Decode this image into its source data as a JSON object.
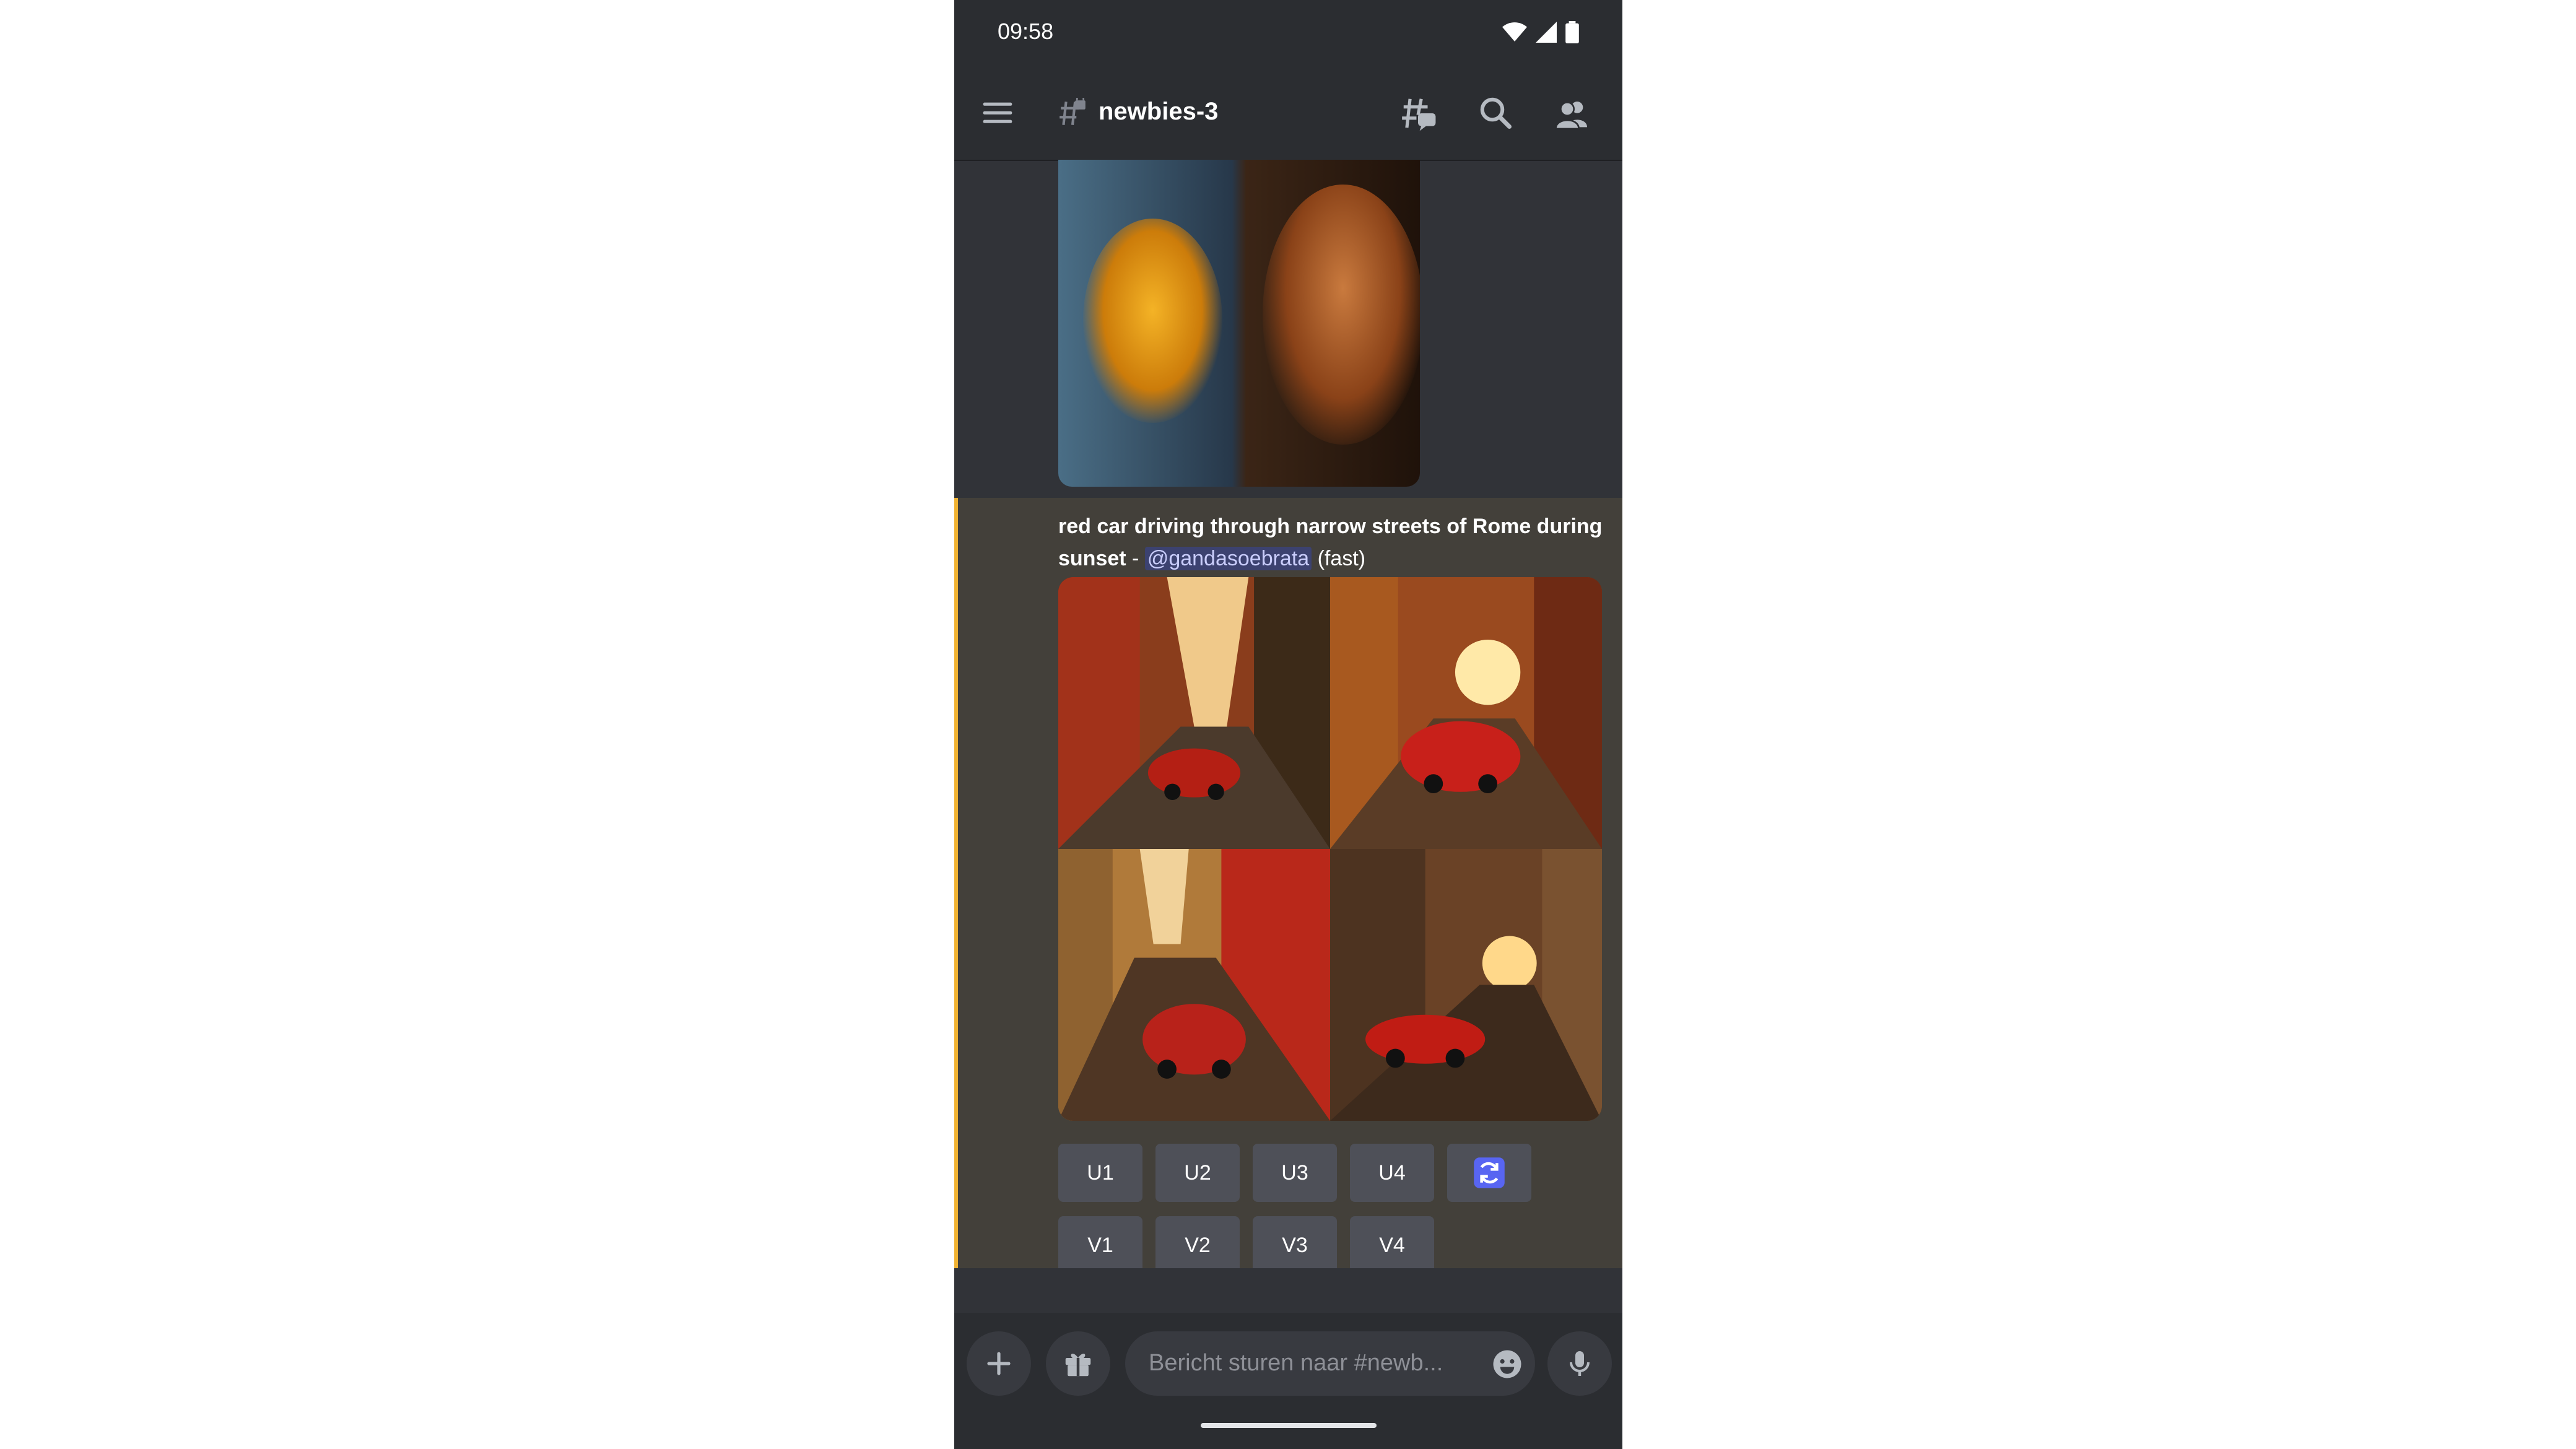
{
  "status_bar": {
    "time": "09:58",
    "icons": [
      "wifi-icon",
      "signal-icon",
      "battery-icon"
    ]
  },
  "header": {
    "channel_name": "newbies-3",
    "icons": [
      "menu-icon",
      "locked-channel-icon",
      "threads-icon",
      "search-icon",
      "members-icon"
    ]
  },
  "message": {
    "prompt": "red car driving through narrow streets of Rome during sunset",
    "separator": " - ",
    "mention": "@gandasoebrata",
    "mode": "(fast)",
    "upscale_buttons": [
      "U1",
      "U2",
      "U3",
      "U4"
    ],
    "variation_buttons": [
      "V1",
      "V2",
      "V3",
      "V4"
    ],
    "reroll_icon": "refresh-icon"
  },
  "composer": {
    "placeholder": "Bericht sturen naar #newb..."
  },
  "colors": {
    "background": "#313338",
    "accent_bar": "#f0b232",
    "mention_bg": "#3c4270",
    "button": "#4e5058",
    "reroll": "#5865f2"
  }
}
